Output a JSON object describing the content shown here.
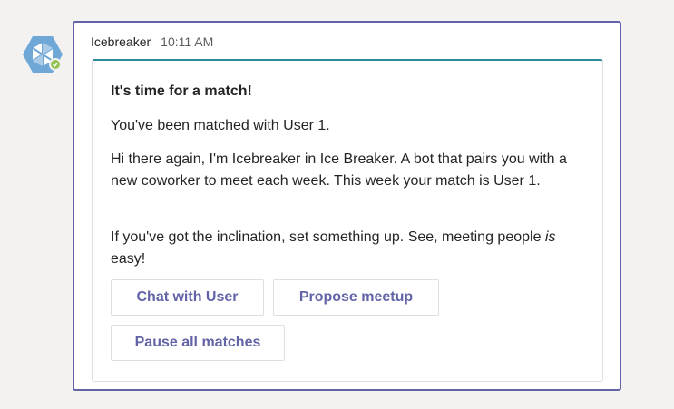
{
  "message": {
    "sender": "Icebreaker",
    "timestamp": "10:11 AM"
  },
  "card": {
    "title": "It's time for a match!",
    "matched_text": "You've been matched with User 1.",
    "intro_text": "Hi there again, I'm Icebreaker in Ice Breaker. A bot that pairs you with a new coworker to meet each week. This week your match is User 1.",
    "closing": {
      "before": "If you've got the inclination, set something up. See, meeting people ",
      "emphasis": "is",
      "after": " easy!"
    },
    "buttons": {
      "chat": "Chat with User",
      "propose": "Propose meetup",
      "pause": "Pause all matches"
    }
  },
  "colors": {
    "accent": "#6264a7",
    "card_top_border": "#2e8c99",
    "avatar": "#6fa8d6",
    "presence_available": "#92c353",
    "background": "#f3f2f1"
  },
  "icons": {
    "avatar": "icebreaker-snowflake-hexagon-icon",
    "presence": "available-check-icon"
  }
}
